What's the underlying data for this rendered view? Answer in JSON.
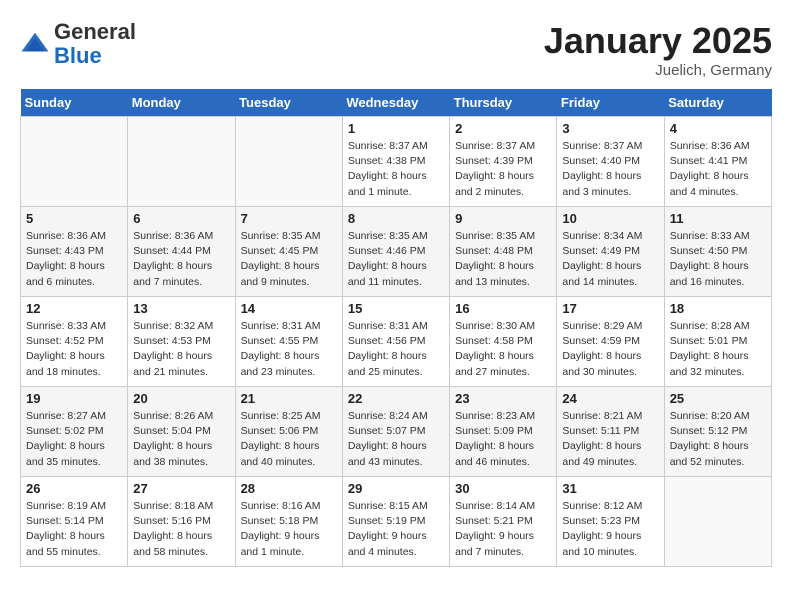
{
  "header": {
    "logo_general": "General",
    "logo_blue": "Blue",
    "month_title": "January 2025",
    "subtitle": "Juelich, Germany"
  },
  "weekdays": [
    "Sunday",
    "Monday",
    "Tuesday",
    "Wednesday",
    "Thursday",
    "Friday",
    "Saturday"
  ],
  "weeks": [
    [
      {
        "day": "",
        "info": ""
      },
      {
        "day": "",
        "info": ""
      },
      {
        "day": "",
        "info": ""
      },
      {
        "day": "1",
        "info": "Sunrise: 8:37 AM\nSunset: 4:38 PM\nDaylight: 8 hours\nand 1 minute."
      },
      {
        "day": "2",
        "info": "Sunrise: 8:37 AM\nSunset: 4:39 PM\nDaylight: 8 hours\nand 2 minutes."
      },
      {
        "day": "3",
        "info": "Sunrise: 8:37 AM\nSunset: 4:40 PM\nDaylight: 8 hours\nand 3 minutes."
      },
      {
        "day": "4",
        "info": "Sunrise: 8:36 AM\nSunset: 4:41 PM\nDaylight: 8 hours\nand 4 minutes."
      }
    ],
    [
      {
        "day": "5",
        "info": "Sunrise: 8:36 AM\nSunset: 4:43 PM\nDaylight: 8 hours\nand 6 minutes."
      },
      {
        "day": "6",
        "info": "Sunrise: 8:36 AM\nSunset: 4:44 PM\nDaylight: 8 hours\nand 7 minutes."
      },
      {
        "day": "7",
        "info": "Sunrise: 8:35 AM\nSunset: 4:45 PM\nDaylight: 8 hours\nand 9 minutes."
      },
      {
        "day": "8",
        "info": "Sunrise: 8:35 AM\nSunset: 4:46 PM\nDaylight: 8 hours\nand 11 minutes."
      },
      {
        "day": "9",
        "info": "Sunrise: 8:35 AM\nSunset: 4:48 PM\nDaylight: 8 hours\nand 13 minutes."
      },
      {
        "day": "10",
        "info": "Sunrise: 8:34 AM\nSunset: 4:49 PM\nDaylight: 8 hours\nand 14 minutes."
      },
      {
        "day": "11",
        "info": "Sunrise: 8:33 AM\nSunset: 4:50 PM\nDaylight: 8 hours\nand 16 minutes."
      }
    ],
    [
      {
        "day": "12",
        "info": "Sunrise: 8:33 AM\nSunset: 4:52 PM\nDaylight: 8 hours\nand 18 minutes."
      },
      {
        "day": "13",
        "info": "Sunrise: 8:32 AM\nSunset: 4:53 PM\nDaylight: 8 hours\nand 21 minutes."
      },
      {
        "day": "14",
        "info": "Sunrise: 8:31 AM\nSunset: 4:55 PM\nDaylight: 8 hours\nand 23 minutes."
      },
      {
        "day": "15",
        "info": "Sunrise: 8:31 AM\nSunset: 4:56 PM\nDaylight: 8 hours\nand 25 minutes."
      },
      {
        "day": "16",
        "info": "Sunrise: 8:30 AM\nSunset: 4:58 PM\nDaylight: 8 hours\nand 27 minutes."
      },
      {
        "day": "17",
        "info": "Sunrise: 8:29 AM\nSunset: 4:59 PM\nDaylight: 8 hours\nand 30 minutes."
      },
      {
        "day": "18",
        "info": "Sunrise: 8:28 AM\nSunset: 5:01 PM\nDaylight: 8 hours\nand 32 minutes."
      }
    ],
    [
      {
        "day": "19",
        "info": "Sunrise: 8:27 AM\nSunset: 5:02 PM\nDaylight: 8 hours\nand 35 minutes."
      },
      {
        "day": "20",
        "info": "Sunrise: 8:26 AM\nSunset: 5:04 PM\nDaylight: 8 hours\nand 38 minutes."
      },
      {
        "day": "21",
        "info": "Sunrise: 8:25 AM\nSunset: 5:06 PM\nDaylight: 8 hours\nand 40 minutes."
      },
      {
        "day": "22",
        "info": "Sunrise: 8:24 AM\nSunset: 5:07 PM\nDaylight: 8 hours\nand 43 minutes."
      },
      {
        "day": "23",
        "info": "Sunrise: 8:23 AM\nSunset: 5:09 PM\nDaylight: 8 hours\nand 46 minutes."
      },
      {
        "day": "24",
        "info": "Sunrise: 8:21 AM\nSunset: 5:11 PM\nDaylight: 8 hours\nand 49 minutes."
      },
      {
        "day": "25",
        "info": "Sunrise: 8:20 AM\nSunset: 5:12 PM\nDaylight: 8 hours\nand 52 minutes."
      }
    ],
    [
      {
        "day": "26",
        "info": "Sunrise: 8:19 AM\nSunset: 5:14 PM\nDaylight: 8 hours\nand 55 minutes."
      },
      {
        "day": "27",
        "info": "Sunrise: 8:18 AM\nSunset: 5:16 PM\nDaylight: 8 hours\nand 58 minutes."
      },
      {
        "day": "28",
        "info": "Sunrise: 8:16 AM\nSunset: 5:18 PM\nDaylight: 9 hours\nand 1 minute."
      },
      {
        "day": "29",
        "info": "Sunrise: 8:15 AM\nSunset: 5:19 PM\nDaylight: 9 hours\nand 4 minutes."
      },
      {
        "day": "30",
        "info": "Sunrise: 8:14 AM\nSunset: 5:21 PM\nDaylight: 9 hours\nand 7 minutes."
      },
      {
        "day": "31",
        "info": "Sunrise: 8:12 AM\nSunset: 5:23 PM\nDaylight: 9 hours\nand 10 minutes."
      },
      {
        "day": "",
        "info": ""
      }
    ]
  ]
}
